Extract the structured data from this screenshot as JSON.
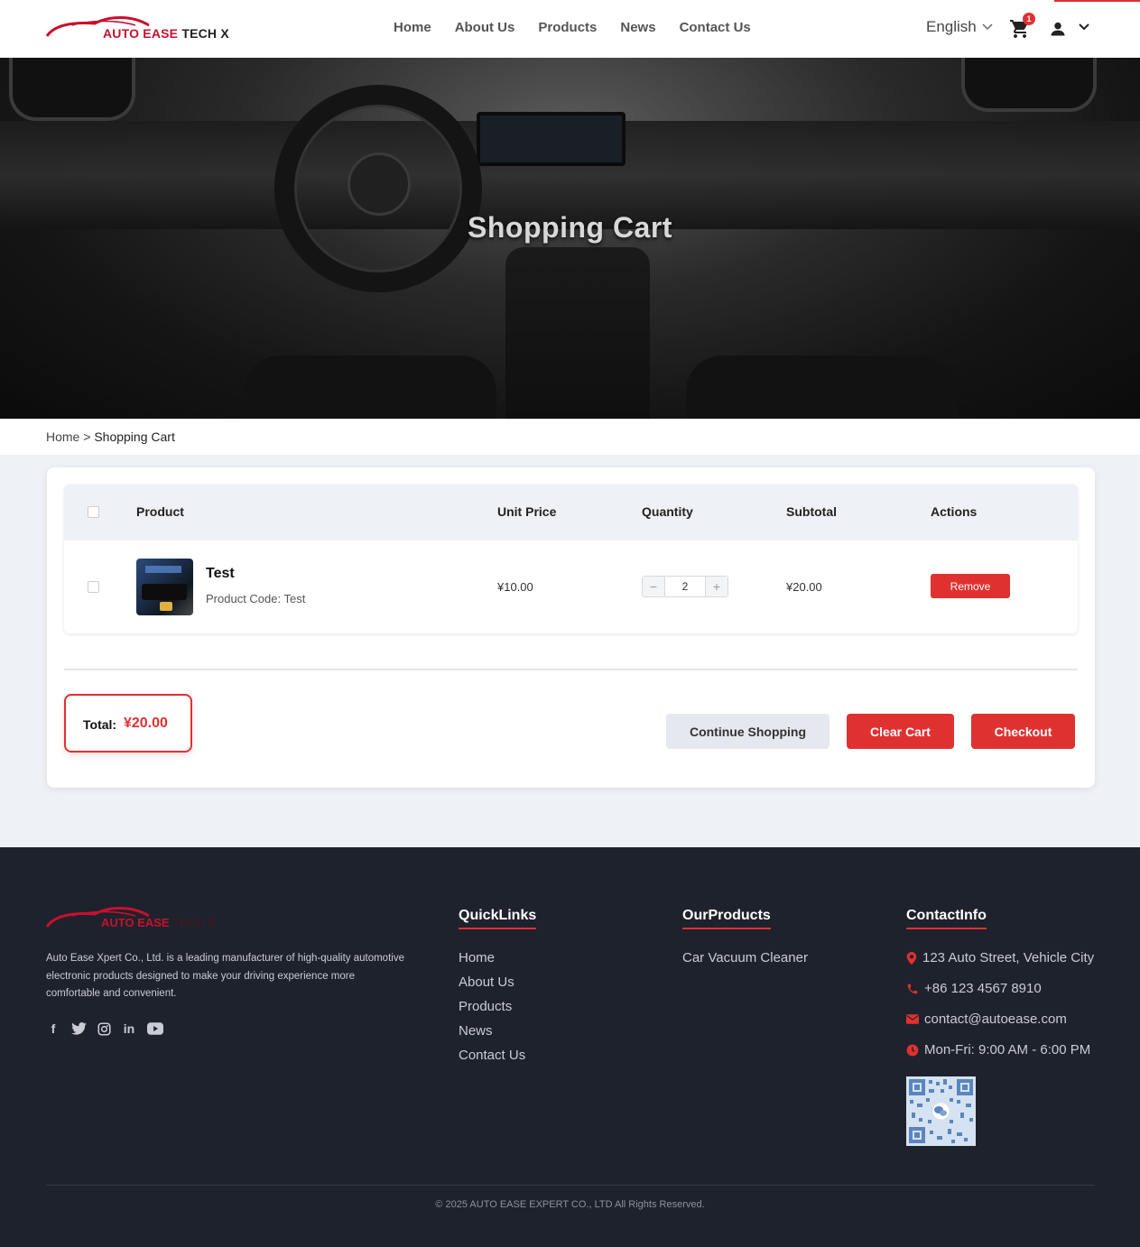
{
  "header": {
    "logo_text_red": "AUTO EASE",
    "logo_text_dark": "TECH X",
    "nav": [
      "Home",
      "About Us",
      "Products",
      "News",
      "Contact Us"
    ],
    "language": "English",
    "cart_count": "1"
  },
  "hero": {
    "title": "Shopping Cart"
  },
  "breadcrumb": {
    "home": "Home",
    "sep": ">",
    "current": "Shopping Cart"
  },
  "cart": {
    "headers": {
      "product": "Product",
      "unit_price": "Unit Price",
      "quantity": "Quantity",
      "subtotal": "Subtotal",
      "actions": "Actions"
    },
    "items": [
      {
        "name": "Test",
        "code": "Product Code: Test",
        "unit_price": "¥10.00",
        "quantity": "2",
        "subtotal": "¥20.00",
        "remove_label": "Remove"
      }
    ],
    "total_label": "Total:",
    "total_value": "¥20.00",
    "continue_label": "Continue Shopping",
    "clear_label": "Clear Cart",
    "checkout_label": "Checkout"
  },
  "footer": {
    "logo_text_red": "AUTO EASE",
    "logo_text_dark": "TECH X",
    "description": "Auto Ease Xpert Co., Ltd. is a leading manufacturer of high-quality automotive electronic products designed to make your driving experience more comfortable and convenient.",
    "social_icons": [
      "facebook-icon",
      "twitter-icon",
      "instagram-icon",
      "linkedin-icon",
      "youtube-icon"
    ],
    "quicklinks_title": "QuickLinks",
    "quicklinks": [
      "Home",
      "About Us",
      "Products",
      "News",
      "Contact Us"
    ],
    "products_title": "OurProducts",
    "products": [
      "Car Vacuum Cleaner"
    ],
    "contact_title": "ContactInfo",
    "contact": {
      "address": "123 Auto Street, Vehicle City",
      "phone": "+86 123 4567 8910",
      "email": "contact@autoease.com",
      "hours": "Mon-Fri: 9:00 AM - 6:00 PM"
    },
    "copyright": "© 2025 AUTO EASE EXPERT CO., LTD All Rights Reserved."
  },
  "colors": {
    "accent": "#e03131",
    "footer_bg": "#1e222c",
    "page_bg": "#eef1f5"
  }
}
